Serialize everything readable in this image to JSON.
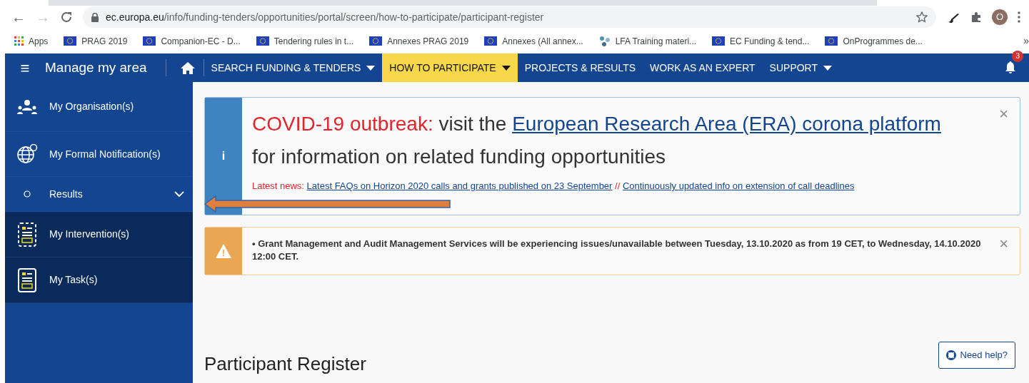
{
  "browser": {
    "back": "←",
    "forward": "→",
    "forward_disabled": true,
    "url": {
      "host": "ec.europa.eu",
      "path": "/info/funding-tenders/opportunities/portal/screen/how-to-participate/participant-register"
    },
    "profile_initial": "O",
    "bookmarks": [
      {
        "label": "Apps",
        "kind": "apps"
      },
      {
        "label": "PRAG 2019",
        "kind": "flag"
      },
      {
        "label": "Companion-EC - D...",
        "kind": "flag"
      },
      {
        "label": "Tendering rules in t...",
        "kind": "flag"
      },
      {
        "label": "Annexes PRAG 2019",
        "kind": "flag"
      },
      {
        "label": "Annexes (All annex...",
        "kind": "flag"
      },
      {
        "label": "LFA Training materi...",
        "kind": "network"
      },
      {
        "label": "EC Funding & tend...",
        "kind": "flag"
      },
      {
        "label": "OnProgrammes de...",
        "kind": "flag"
      }
    ],
    "bookmarks_more": "»"
  },
  "navbar": {
    "menu": "≡",
    "title": "Manage my area",
    "notifications": "3",
    "items": [
      {
        "label": "SEARCH FUNDING & TENDERS",
        "dropdown": true,
        "selected": false
      },
      {
        "label": "HOW TO PARTICIPATE",
        "dropdown": true,
        "selected": true
      },
      {
        "label": "PROJECTS & RESULTS",
        "dropdown": false,
        "selected": false
      },
      {
        "label": "WORK AS AN EXPERT",
        "dropdown": false,
        "selected": false
      },
      {
        "label": "SUPPORT",
        "dropdown": true,
        "selected": false
      }
    ]
  },
  "sidebar": {
    "items": [
      {
        "label": "My Organisation(s)",
        "kind": "people"
      },
      {
        "label": "My Formal Notification(s)",
        "kind": "globe"
      },
      {
        "label": "Results",
        "kind": "dot",
        "expanded": true,
        "children": [
          {
            "label": "My Intervention(s)",
            "kind": "dashed-doc"
          },
          {
            "label": "My Task(s)",
            "kind": "doc"
          }
        ]
      }
    ]
  },
  "alerts": [
    {
      "kind": "info",
      "icon": "i",
      "lead": "COVID-19 outbreak:",
      "text": "visit the",
      "link": "European Research Area (ERA) corona platform",
      "text2": "for information on related funding opportunities",
      "news_label": "Latest news:",
      "news_links": [
        "Latest FAQs on Horizon 2020 calls and grants published on 23 September",
        "Continuously updated info on extension of call deadlines"
      ],
      "news_separator": "//",
      "close": "×"
    },
    {
      "kind": "warning",
      "icon": "!",
      "text": "• Grant Management and Audit Management Services will be experiencing issues/unavailable between Tuesday, 13.10.2020 as from 19 CET, to Wednesday, 14.10.2020 12:00 CET.",
      "close": "×"
    }
  ],
  "page": {
    "title": "Participant Register",
    "help": "Need help?"
  }
}
